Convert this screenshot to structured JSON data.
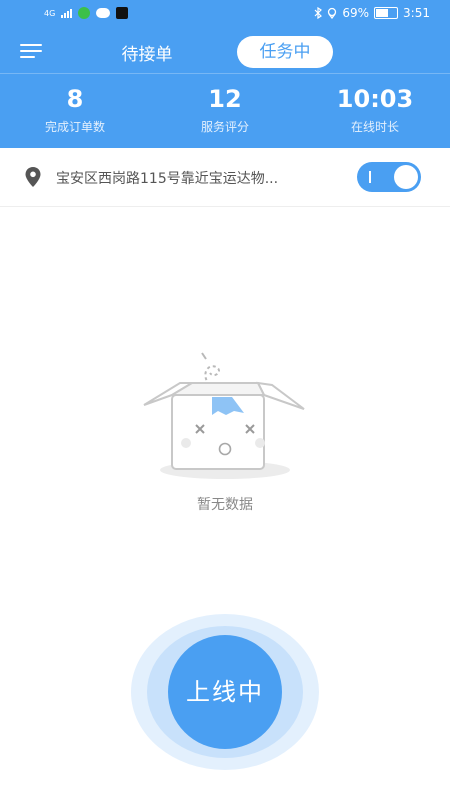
{
  "status_bar": {
    "network_label": "4G",
    "battery_percent": "69%",
    "time": "3:51",
    "battery_level": 0.69
  },
  "nav": {
    "tab_pending": "待接单",
    "tab_active": "任务中"
  },
  "stats": [
    {
      "value": "8",
      "label": "完成订单数"
    },
    {
      "value": "12",
      "label": "服务评分"
    },
    {
      "value": "10:03",
      "label": "在线时长"
    }
  ],
  "location": {
    "address": "宝安区西岗路115号靠近宝运达物..."
  },
  "toggle": {
    "state": "on"
  },
  "empty": {
    "text": "暂无数据"
  },
  "online_button": {
    "label": "上线中"
  },
  "colors": {
    "primary": "#4a9ff2",
    "ring_light": "#e3f0fd",
    "ring_mid": "#c8e1fb"
  }
}
